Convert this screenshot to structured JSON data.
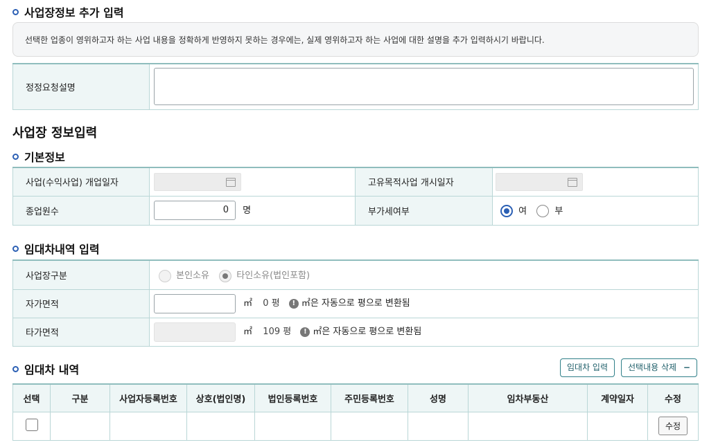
{
  "section1": {
    "title": "사업장정보 추가 입력",
    "notice": "선택한 업종이 영위하고자 하는 사업 내용을 정확하게 반영하지 못하는 경우에는, 실제 영위하고자 하는 사업에 대한 설명을 추가 입력하시기 바랍니다.",
    "correction_label": "정정요청설명",
    "correction_value": ""
  },
  "page_title": "사업장 정보입력",
  "basic": {
    "title": "기본정보",
    "open_date_label": "사업(수익사업) 개업일자",
    "open_date_value": "",
    "unique_date_label": "고유목적사업 개시일자",
    "unique_date_value": "",
    "employees_label": "종업원수",
    "employees_value": "0",
    "employees_unit": "명",
    "vat_label": "부가세여부",
    "vat_options": [
      "여",
      "부"
    ],
    "vat_selected": "여"
  },
  "lease_input": {
    "title": "임대차내역 입력",
    "site_type_label": "사업장구분",
    "site_type_options": [
      "본인소유",
      "타인소유(법인포함)"
    ],
    "site_type_selected": "타인소유(법인포함)",
    "own_area_label": "자가면적",
    "own_area_value": "",
    "own_area_unit": "㎡",
    "own_area_pyeong": "0 평",
    "other_area_label": "타가면적",
    "other_area_value": "",
    "other_area_unit": "㎡",
    "other_area_pyeong": "109 평",
    "auto_convert_note": "㎡은 자동으로 평으로 변환됨"
  },
  "lease_list": {
    "title": "임대차 내역",
    "btn_add": "임대차 입력",
    "btn_delete": "선택내용 삭제",
    "btn_delete_icon": "minus-icon",
    "columns": [
      "선택",
      "구분",
      "사업자등록번호",
      "상호(법인명)",
      "법인등록번호",
      "주민등록번호",
      "성명",
      "임차부동산",
      "계약일자",
      "수정"
    ],
    "rows": [
      {
        "type": "",
        "biz_no": "",
        "company": "",
        "corp_no": "",
        "resident_no": "",
        "name": "",
        "property": "",
        "contract_date": "",
        "edit_label": "수정"
      }
    ]
  }
}
